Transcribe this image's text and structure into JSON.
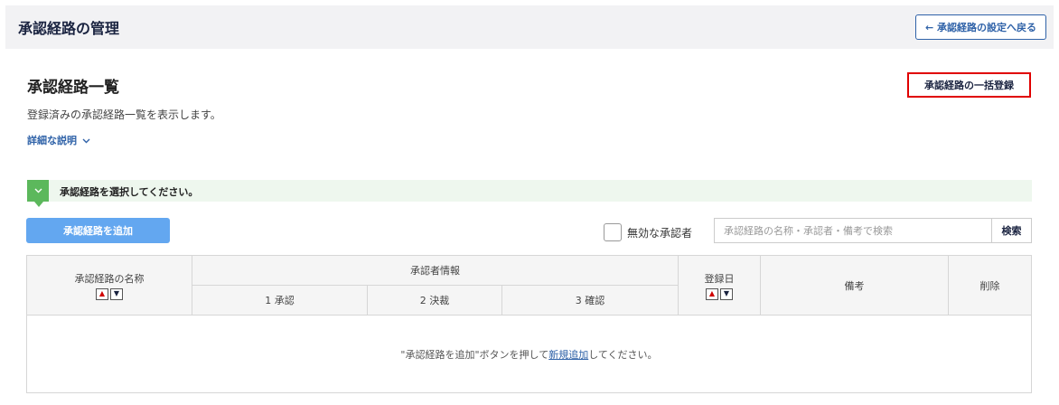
{
  "header": {
    "title": "承認経路の管理",
    "back_button": "← 承認経路の設定へ戻る"
  },
  "section": {
    "title": "承認経路一覧",
    "description": "登録済みの承認経路一覧を表示します。",
    "detail_link": "詳細な説明",
    "bulk_register_button": "承認経路の一括登録"
  },
  "notice": {
    "message": "承認経路を選択してください。"
  },
  "toolbar": {
    "add_button": "承認経路を追加",
    "inactive_checkbox_label": "無効な承認者",
    "search_placeholder": "承認経路の名称・承認者・備考で検索",
    "search_button": "検索"
  },
  "table": {
    "col_name": "承認経路の名称",
    "col_approver_info": "承認者情報",
    "sub_cols": [
      "1 承認",
      "2 決裁",
      "3 確認"
    ],
    "col_registered": "登録日",
    "col_note": "備考",
    "col_delete": "削除",
    "empty_prefix": "\"承認経路を追加\"ボタンを押して",
    "empty_link": "新規追加",
    "empty_suffix": "してください。"
  },
  "colors": {
    "accent": "#2f62a8",
    "add_button": "#63a7f0",
    "notice_badge": "#5cb85c",
    "highlight": "#e00000"
  }
}
